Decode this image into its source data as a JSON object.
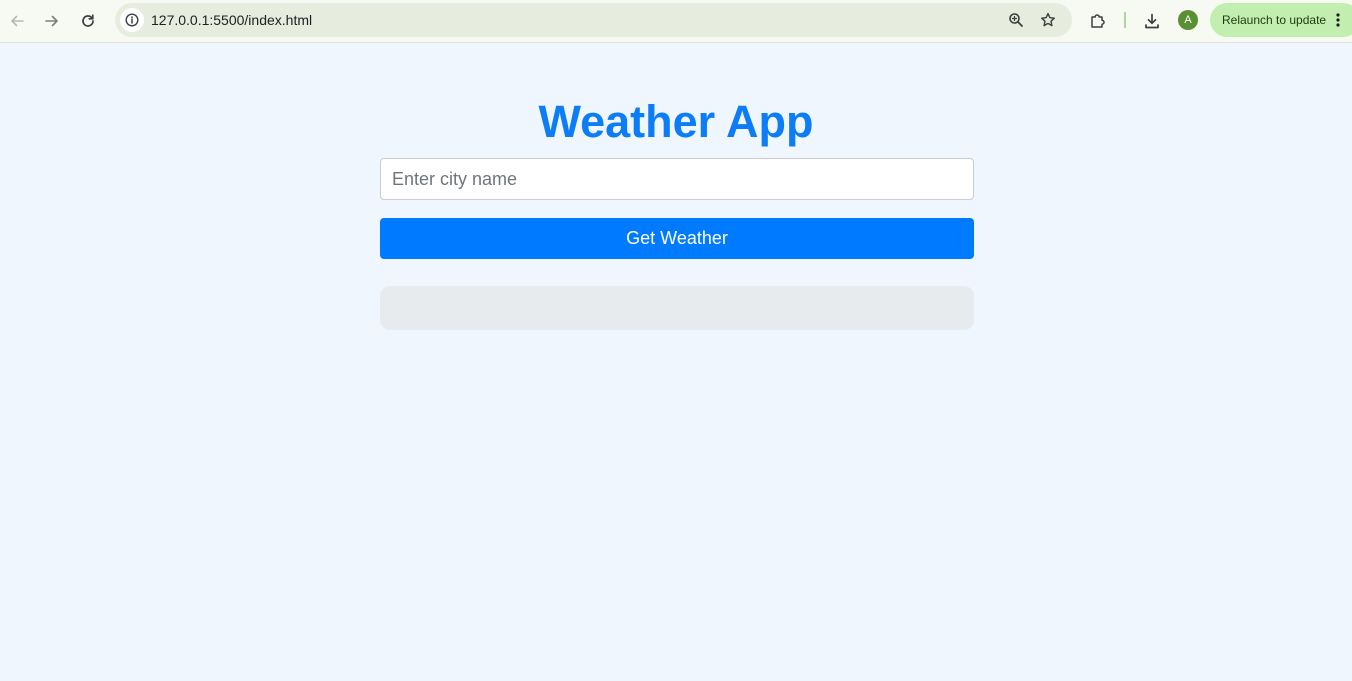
{
  "browser": {
    "url": "127.0.0.1:5500/index.html",
    "relaunch_label": "Relaunch to update",
    "profile_initial": "A"
  },
  "icons": {
    "back": "back-arrow-icon",
    "forward": "forward-arrow-icon",
    "reload": "reload-icon",
    "site_info": "info-icon",
    "zoom": "zoom-icon",
    "bookmark": "star-icon",
    "extensions": "puzzle-icon",
    "downloads": "download-icon",
    "menu": "more-vert-icon"
  },
  "app": {
    "title": "Weather App",
    "city_input": {
      "placeholder": "Enter city name",
      "value": ""
    },
    "submit_label": "Get Weather",
    "result_text": ""
  },
  "colors": {
    "page_background": "#eff6fe",
    "title": "#0d7df7",
    "button": "#007bff",
    "result_panel": "#e8ebee",
    "relaunch_chip": "#c2efb0",
    "avatar": "#5a8f33"
  }
}
